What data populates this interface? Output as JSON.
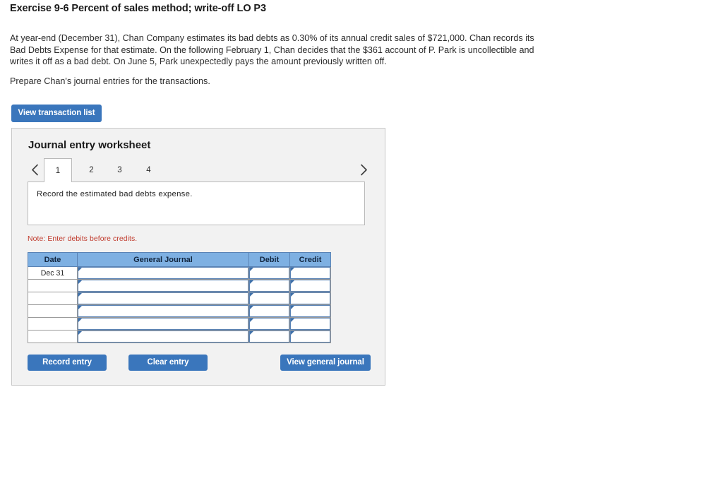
{
  "exercise": {
    "title": "Exercise 9-6 Percent of sales method; write-off LO P3",
    "paragraph": "At year-end (December 31), Chan Company estimates its bad debts as 0.30% of its annual credit sales of $721,000. Chan records its Bad Debts Expense for that estimate. On the following February 1, Chan decides that the $361 account of P. Park is uncollectible and writes it off as a bad debt. On June 5, Park unexpectedly pays the amount previously written off.",
    "requirement": "Prepare Chan's journal entries for the transactions."
  },
  "toolbar": {
    "view_transaction_list_label": "View transaction list"
  },
  "worksheet": {
    "title": "Journal entry worksheet",
    "prev_arrow_icon": "chevron-left-icon",
    "next_arrow_icon": "chevron-right-icon",
    "tabs": [
      {
        "label": "1",
        "active": true
      },
      {
        "label": "2",
        "active": false
      },
      {
        "label": "3",
        "active": false
      },
      {
        "label": "4",
        "active": false
      }
    ],
    "instruction": "Record the estimated bad debts expense.",
    "note": "Note: Enter debits before credits.",
    "table": {
      "headers": [
        "Date",
        "General Journal",
        "Debit",
        "Credit"
      ],
      "rows": [
        {
          "date": "Dec 31",
          "general_journal": "",
          "debit": "",
          "credit": ""
        },
        {
          "date": "",
          "general_journal": "",
          "debit": "",
          "credit": ""
        },
        {
          "date": "",
          "general_journal": "",
          "debit": "",
          "credit": ""
        },
        {
          "date": "",
          "general_journal": "",
          "debit": "",
          "credit": ""
        },
        {
          "date": "",
          "general_journal": "",
          "debit": "",
          "credit": ""
        },
        {
          "date": "",
          "general_journal": "",
          "debit": "",
          "credit": ""
        }
      ]
    },
    "footer": {
      "record_entry_label": "Record entry",
      "clear_entry_label": "Clear entry",
      "view_general_journal_label": "View general journal"
    }
  },
  "colors": {
    "button_blue": "#3a76bc",
    "table_header_blue": "#7eb0e2",
    "field_border_blue": "#5a83b5",
    "note_red": "#c0392b",
    "panel_gray": "#f2f2f2"
  }
}
